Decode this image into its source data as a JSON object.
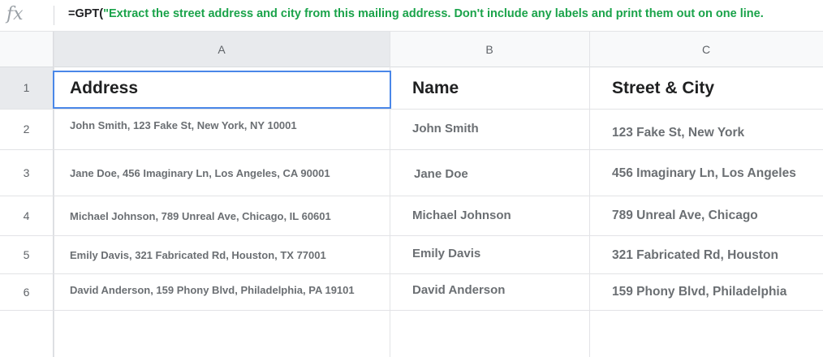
{
  "formula_bar": {
    "fx_label": "fx",
    "formula_prefix": "=GPT(",
    "formula_string": "\"Extract the street address and city from this mailing address. Don't include any labels and print them out on one line."
  },
  "columns": [
    "A",
    "B",
    "C"
  ],
  "rows": [
    "1",
    "2",
    "3",
    "4",
    "5",
    "6"
  ],
  "cells": [
    [
      "Address",
      "Name",
      "Street & City"
    ],
    [
      "John Smith, 123 Fake St, New York, NY 10001",
      "John Smith",
      "123 Fake St, New York"
    ],
    [
      "Jane Doe, 456 Imaginary Ln, Los Angeles, CA 90001",
      "Jane Doe",
      "456 Imaginary Ln, Los Angeles"
    ],
    [
      "Michael Johnson, 789 Unreal Ave, Chicago, IL 60601",
      "Michael Johnson",
      "789 Unreal Ave, Chicago"
    ],
    [
      "Emily Davis, 321 Fabricated Rd, Houston, TX 77001",
      "Emily Davis",
      "321 Fabricated Rd, Houston"
    ],
    [
      "David Anderson, 159 Phony Blvd, Philadelphia, PA 19101",
      "David Anderson",
      "159 Phony Blvd, Philadelphia"
    ]
  ],
  "selected_cell": "A1",
  "colors": {
    "selection": "#4a87e8",
    "formula_string": "#1aa34a"
  }
}
